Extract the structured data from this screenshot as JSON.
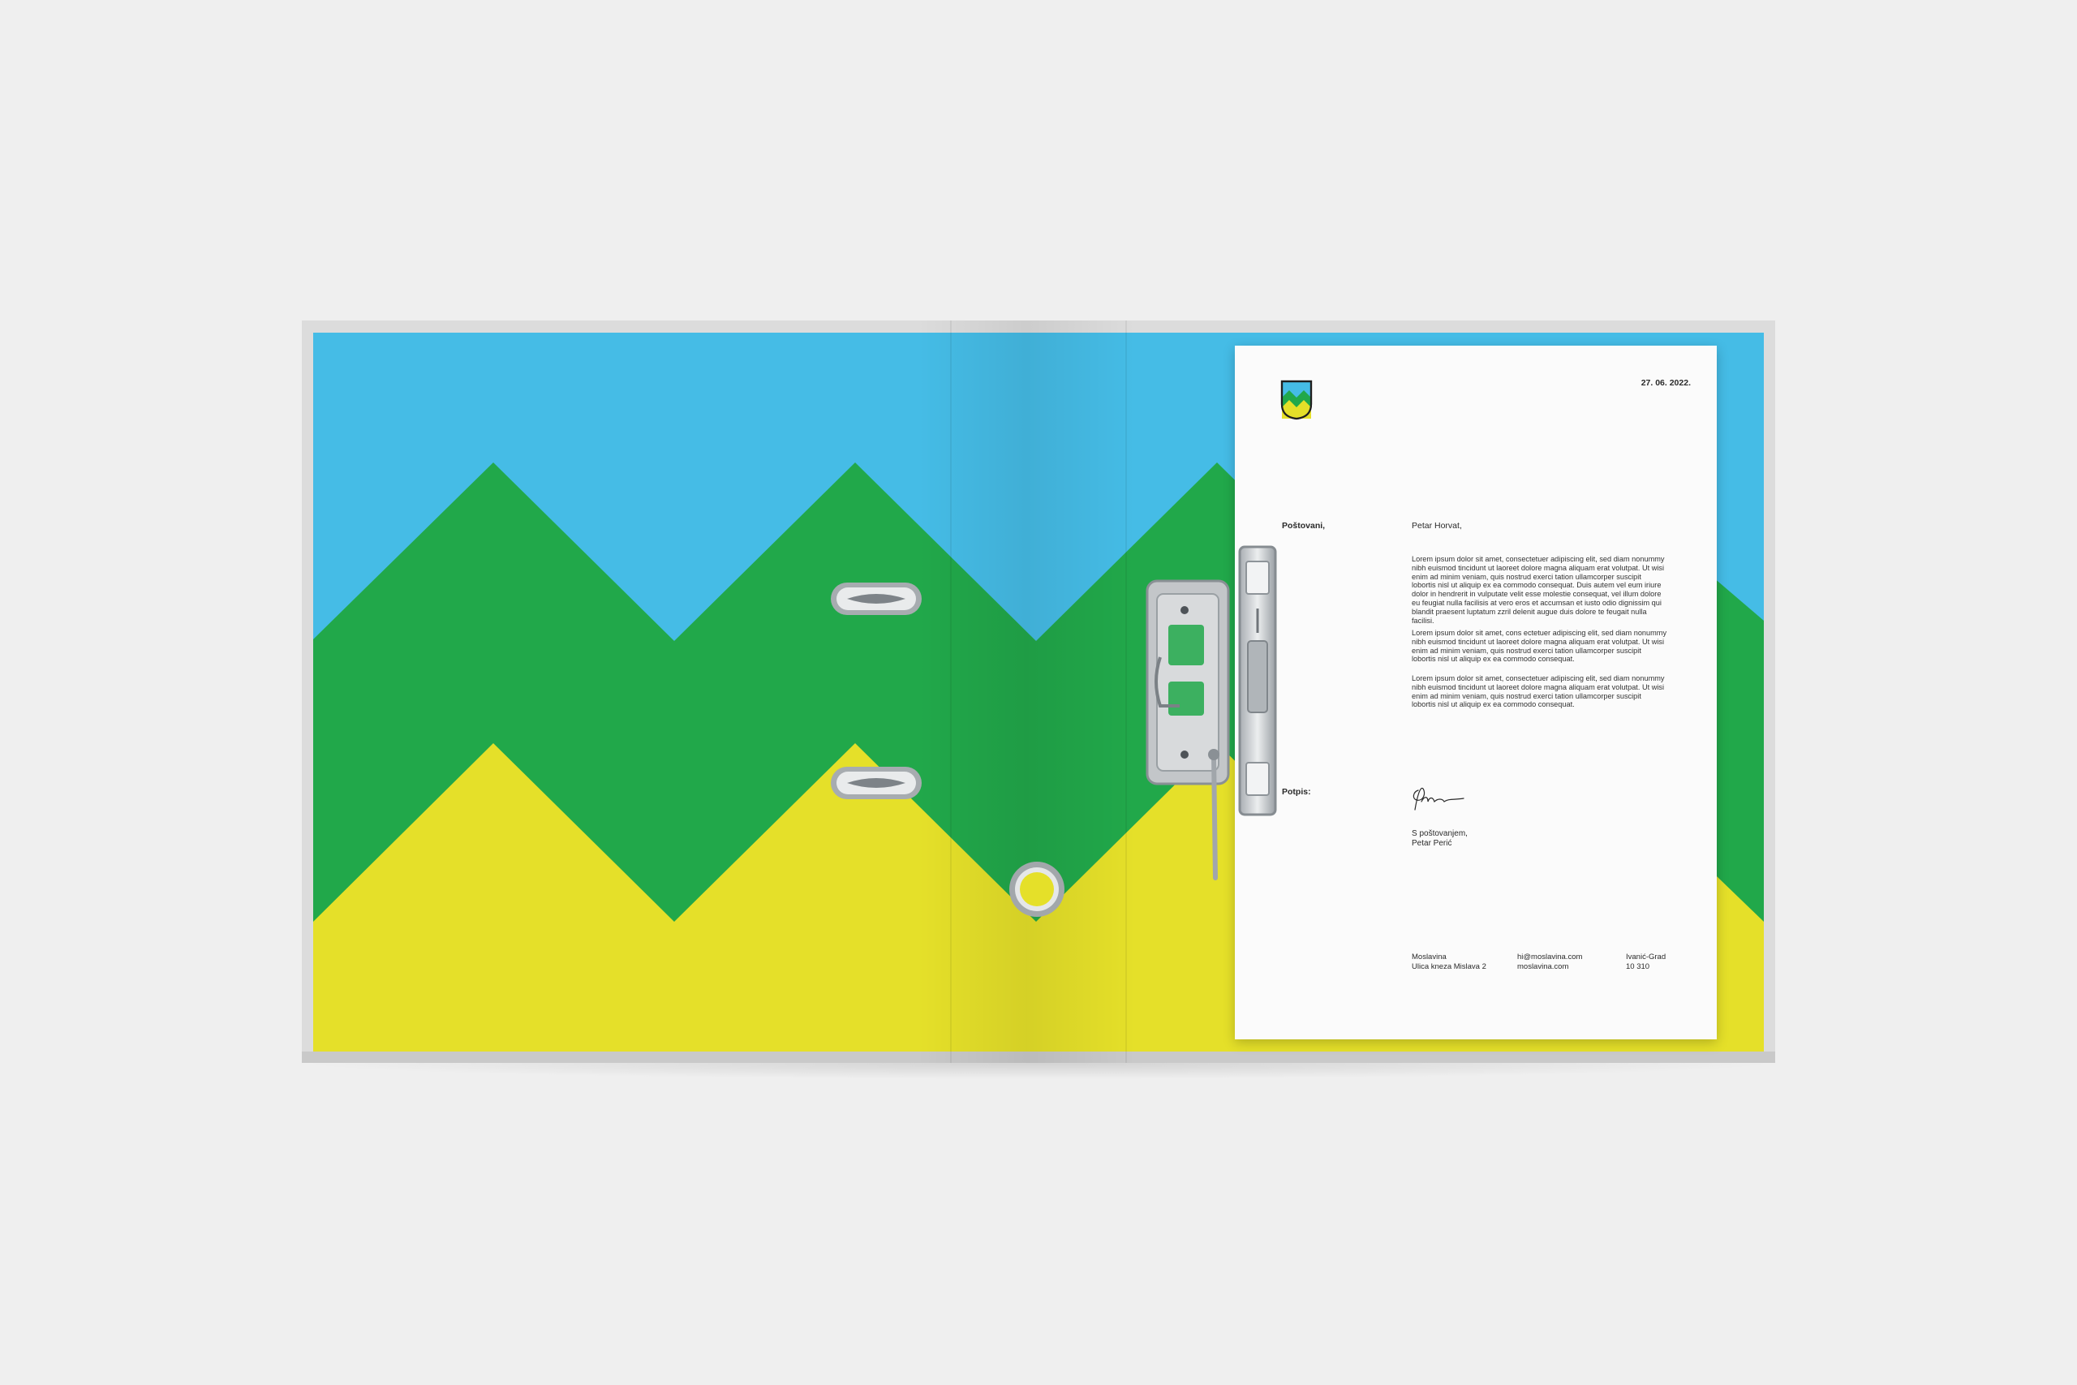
{
  "colors": {
    "background": "#efefef",
    "sky_blue": "#45bce6",
    "green": "#21a84a",
    "yellow": "#e5e029",
    "paper": "#fbfbfb",
    "metal": "#c3c6c9"
  },
  "letter": {
    "crest_icon": "mountain-shield-icon",
    "date": "27. 06. 2022.",
    "salutation_label": "Poštovani,",
    "recipient": "Petar Horvat,",
    "paragraph_1": "Lorem ipsum dolor sit amet, consectetuer adipiscing elit, sed diam nonummy nibh euismod tincidunt ut laoreet dolore magna aliquam erat volutpat. Ut wisi enim ad minim veniam, quis nostrud exerci tation ullamcorper suscipit lobortis nisl ut aliquip ex ea commodo consequat. Duis autem vel eum iriure dolor in hendrerit in vulputate velit esse molestie consequat, vel illum dolore eu feugiat nulla facilisis at vero eros et accumsan et iusto odio dignissim qui blandit praesent luptatum zzril delenit augue duis dolore te feugait nulla facilisi.",
    "paragraph_2": "Lorem ipsum dolor sit amet, cons ectetuer adipiscing elit, sed diam nonummy nibh euismod tincidunt ut laoreet dolore magna aliquam erat volutpat. Ut wisi enim ad minim veniam, quis nostrud exerci tation ullamcorper suscipit lobortis nisl ut aliquip ex ea commodo consequat.",
    "paragraph_3": "Lorem ipsum dolor sit amet, consectetuer adipiscing elit, sed diam nonummy nibh euismod tincidunt ut laoreet dolore magna aliquam erat volutpat. Ut wisi enim ad minim veniam, quis nostrud exerci tation ullamcorper suscipit lobortis nisl ut aliquip ex ea commodo consequat.",
    "signature_label": "Potpis:",
    "closing_line_1": "S poštovanjem,",
    "closing_line_2": "Petar Perić",
    "footer": {
      "org": "Moslavina",
      "address": "Ulica kneza Mislava 2",
      "email": "hi@moslavina.com",
      "website": "moslavina.com",
      "city": "Ivanić-Grad",
      "postcode": "10 310"
    }
  }
}
